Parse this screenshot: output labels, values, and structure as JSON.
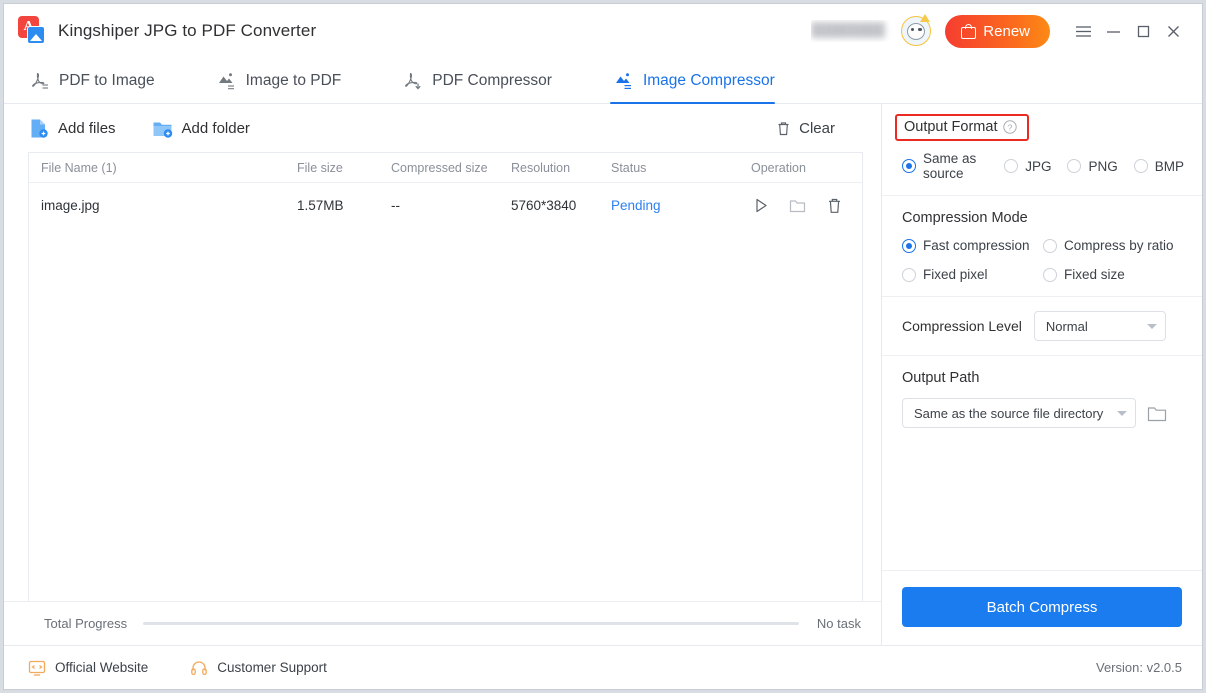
{
  "window": {
    "app_title": "Kingshiper JPG to PDF Converter",
    "logo_icon": "pdf-to-image-logo",
    "username_masked": "████████",
    "avatar_icon": "user-avatar-crown",
    "renew_label": "Renew",
    "renew_icon": "shopping-bag-icon",
    "menu_icon": "hamburger-menu-icon",
    "minimize_icon": "minimize-icon",
    "maximize_icon": "maximize-icon",
    "close_icon": "close-icon",
    "accent_blue": "#1a73e8",
    "renew_gradient_from": "#f53d30",
    "renew_gradient_to": "#fd8a15"
  },
  "tabs": [
    {
      "label": "PDF to Image",
      "icon": "pdf-to-image-icon",
      "active": false
    },
    {
      "label": "Image to PDF",
      "icon": "image-to-pdf-icon",
      "active": false
    },
    {
      "label": "PDF Compressor",
      "icon": "pdf-compressor-icon",
      "active": false
    },
    {
      "label": "Image Compressor",
      "icon": "image-compressor-icon",
      "active": true
    }
  ],
  "toolbar": {
    "add_files_label": "Add files",
    "add_files_icon": "add-file-icon",
    "add_folder_label": "Add folder",
    "add_folder_icon": "add-folder-icon",
    "clear_label": "Clear",
    "clear_icon": "trash-icon"
  },
  "table": {
    "headers": {
      "name": "File Name (1)",
      "size": "File size",
      "compressed": "Compressed size",
      "resolution": "Resolution",
      "status": "Status",
      "operation": "Operation"
    },
    "rows": [
      {
        "name": "image.jpg",
        "size": "1.57MB",
        "compressed": "--",
        "resolution": "5760*3840",
        "status": "Pending",
        "status_color": "#2d7ff0",
        "ops": [
          "play-icon",
          "open-folder-icon",
          "delete-icon"
        ]
      }
    ]
  },
  "progress": {
    "label": "Total Progress",
    "percent": 0,
    "status": "No task"
  },
  "settings": {
    "output_format": {
      "title": "Output Format",
      "help_icon": "help-circle-icon",
      "highlighted": true,
      "highlight_color": "#ec2a24",
      "options": [
        {
          "label": "Same as source",
          "selected": true
        },
        {
          "label": "JPG",
          "selected": false
        },
        {
          "label": "PNG",
          "selected": false
        },
        {
          "label": "BMP",
          "selected": false
        }
      ]
    },
    "compression_mode": {
      "title": "Compression Mode",
      "options": [
        {
          "label": "Fast compression",
          "selected": true
        },
        {
          "label": "Compress by ratio",
          "selected": false
        },
        {
          "label": "Fixed pixel",
          "selected": false
        },
        {
          "label": "Fixed size",
          "selected": false
        }
      ]
    },
    "compression_level": {
      "label": "Compression Level",
      "value": "Normal"
    },
    "output_path": {
      "title": "Output Path",
      "value": "Same as the source file directory",
      "browse_icon": "folder-browse-icon"
    },
    "batch_button": "Batch Compress"
  },
  "footer": {
    "official_website": "Official Website",
    "official_website_icon": "monitor-icon",
    "customer_support": "Customer Support",
    "customer_support_icon": "headset-icon",
    "version": "Version: v2.0.5"
  }
}
